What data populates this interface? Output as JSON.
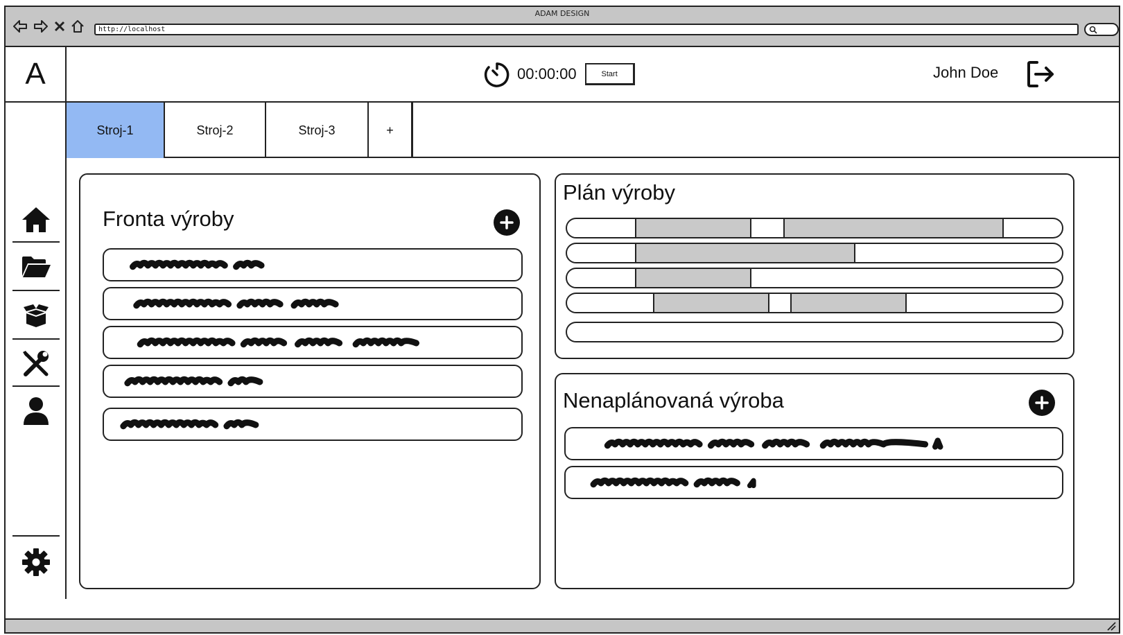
{
  "browser": {
    "title": "ADAM DESIGN",
    "url": "http://localhost"
  },
  "header": {
    "logo": "A",
    "timer": "00:00:00",
    "start_label": "Start",
    "user_name": "John Doe"
  },
  "sidebar": {
    "items": [
      {
        "icon": "home-icon"
      },
      {
        "icon": "folder-open-icon"
      },
      {
        "icon": "box-icon"
      },
      {
        "icon": "tools-icon"
      },
      {
        "icon": "user-icon"
      }
    ],
    "bottom_icon": "gear-icon"
  },
  "tabs": [
    {
      "label": "Stroj-1",
      "active": true
    },
    {
      "label": "Stroj-2",
      "active": false
    },
    {
      "label": "Stroj-3",
      "active": false
    },
    {
      "label": "+",
      "active": false
    }
  ],
  "queue": {
    "title": "Fronta výroby"
  },
  "plan": {
    "title": "Plán výroby"
  },
  "unplanned": {
    "title": "Nenaplánovaná výroba"
  },
  "colors": {
    "active_tab": "#93b9f3",
    "gantt_bar": "#c9c9c9",
    "chrome": "#c6c6c6"
  }
}
